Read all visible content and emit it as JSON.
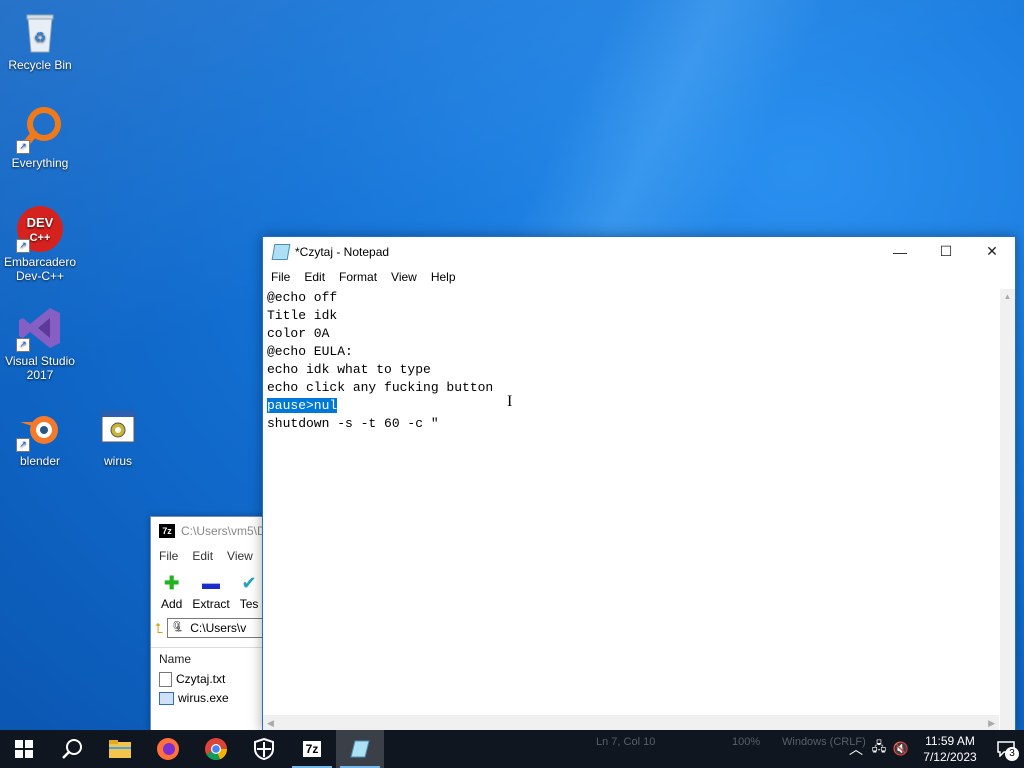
{
  "desktop": {
    "icons": [
      {
        "label": "Recycle Bin"
      },
      {
        "label": "Everything"
      },
      {
        "label": "Embarcadero Dev-C++"
      },
      {
        "label": "Visual Studio 2017"
      },
      {
        "label": "blender"
      },
      {
        "label": "wirus"
      }
    ]
  },
  "sevenzip": {
    "title": "C:\\Users\\vm5\\D",
    "menu": [
      "File",
      "Edit",
      "View"
    ],
    "tools": [
      "Add",
      "Extract",
      "Tes"
    ],
    "address": "C:\\Users\\v",
    "column_name": "Name",
    "files": [
      "Czytaj.txt",
      "wirus.exe"
    ]
  },
  "notepad": {
    "title": "*Czytaj - Notepad",
    "menu": [
      "File",
      "Edit",
      "Format",
      "View",
      "Help"
    ],
    "lines": [
      "@echo off",
      "Title idk",
      "color 0A",
      "@echo EULA:",
      "echo idk what to type",
      "echo click any fucking button",
      "pause>nul",
      "shutdown -s -t 60 -c \""
    ],
    "selected_line_index": 6,
    "status": {
      "position": "Ln 7, Col 10",
      "zoom": "100%",
      "encoding": "Windows (CRLF)"
    }
  },
  "taskbar": {
    "time": "11:59 AM",
    "date": "7/12/2023",
    "notification_count": "3",
    "colors": {
      "background": "#10161f",
      "accent": "#76b9ed"
    }
  }
}
